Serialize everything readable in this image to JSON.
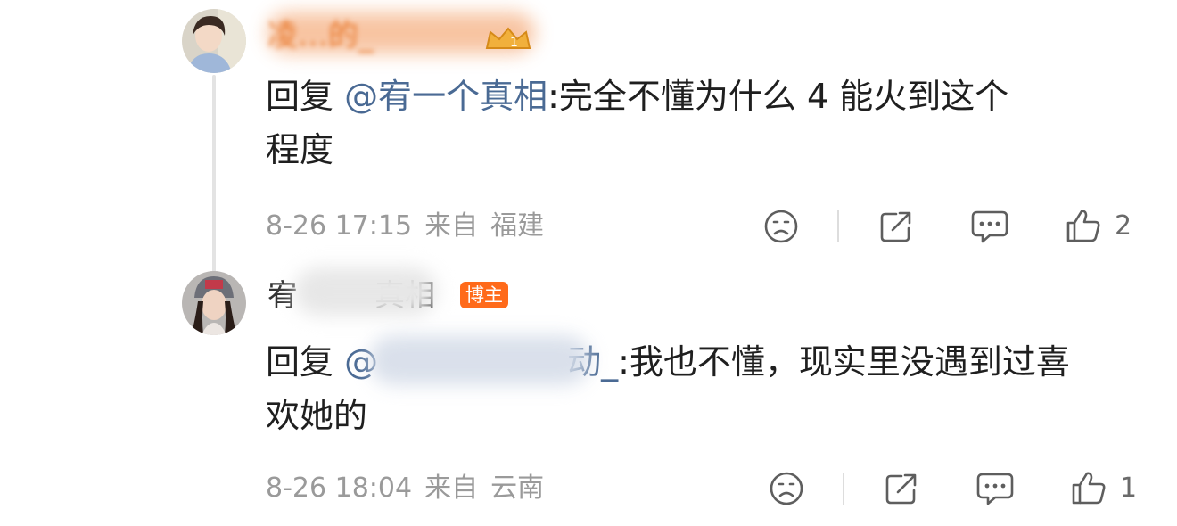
{
  "comments": [
    {
      "username": "凌…的_",
      "mention": "@宥一个真相",
      "reply_prefix": "回复",
      "text_after": ":完全不懂为什么 4 能火到这个程度",
      "line1_after": ":完全不懂为什么 4 能火到这个",
      "line2": "程度",
      "date": "8-26 17:15",
      "from_label": "来自",
      "location": "福建",
      "likes": "2",
      "badge_number": "1"
    },
    {
      "username_prefix": "宥",
      "username_suffix": "真相",
      "badge": "博主",
      "reply_prefix": "回复",
      "mention": "@",
      "mention_tail": "动_",
      "line1_after": ":我也不懂，现实里没遇到过喜",
      "line2": "欢她的",
      "date": "8-26 18:04",
      "from_label": "来自",
      "location": "云南",
      "likes": "1"
    }
  ],
  "icons": {
    "dislike": "sad-face-icon",
    "share": "share-icon",
    "comment": "comment-icon",
    "like": "thumbs-up-icon"
  },
  "colors": {
    "mention": "#4a6a94",
    "username_vip": "#e8772a",
    "host_badge": "#ff6a1a",
    "meta": "#9a9a9a"
  }
}
